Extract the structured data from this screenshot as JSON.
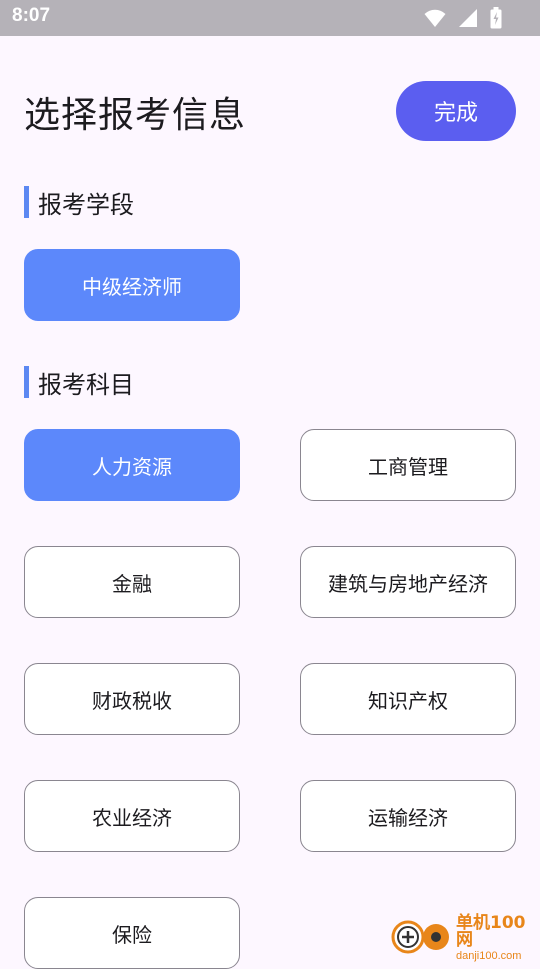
{
  "status_bar": {
    "time": "8:07",
    "icons": [
      "wifi-icon",
      "signal-icon",
      "battery-charging-icon"
    ]
  },
  "header": {
    "title": "选择报考信息",
    "done_label": "完成"
  },
  "stage_section": {
    "title": "报考学段",
    "options": [
      {
        "label": "中级经济师",
        "selected": true
      }
    ]
  },
  "subject_section": {
    "title": "报考科目",
    "options": [
      {
        "label": "人力资源",
        "selected": true
      },
      {
        "label": "工商管理",
        "selected": false
      },
      {
        "label": "金融",
        "selected": false
      },
      {
        "label": "建筑与房地产经济",
        "selected": false
      },
      {
        "label": "财政税收",
        "selected": false
      },
      {
        "label": "知识产权",
        "selected": false
      },
      {
        "label": "农业经济",
        "selected": false
      },
      {
        "label": "运输经济",
        "selected": false
      },
      {
        "label": "保险",
        "selected": false
      }
    ]
  },
  "watermark": {
    "main": "单机100网",
    "sub": "danji100.com"
  },
  "colors": {
    "accent": "#5b5ef0",
    "selected": "#5c88fb",
    "section_bar": "#5c88f2",
    "background": "#fdf7ff"
  }
}
